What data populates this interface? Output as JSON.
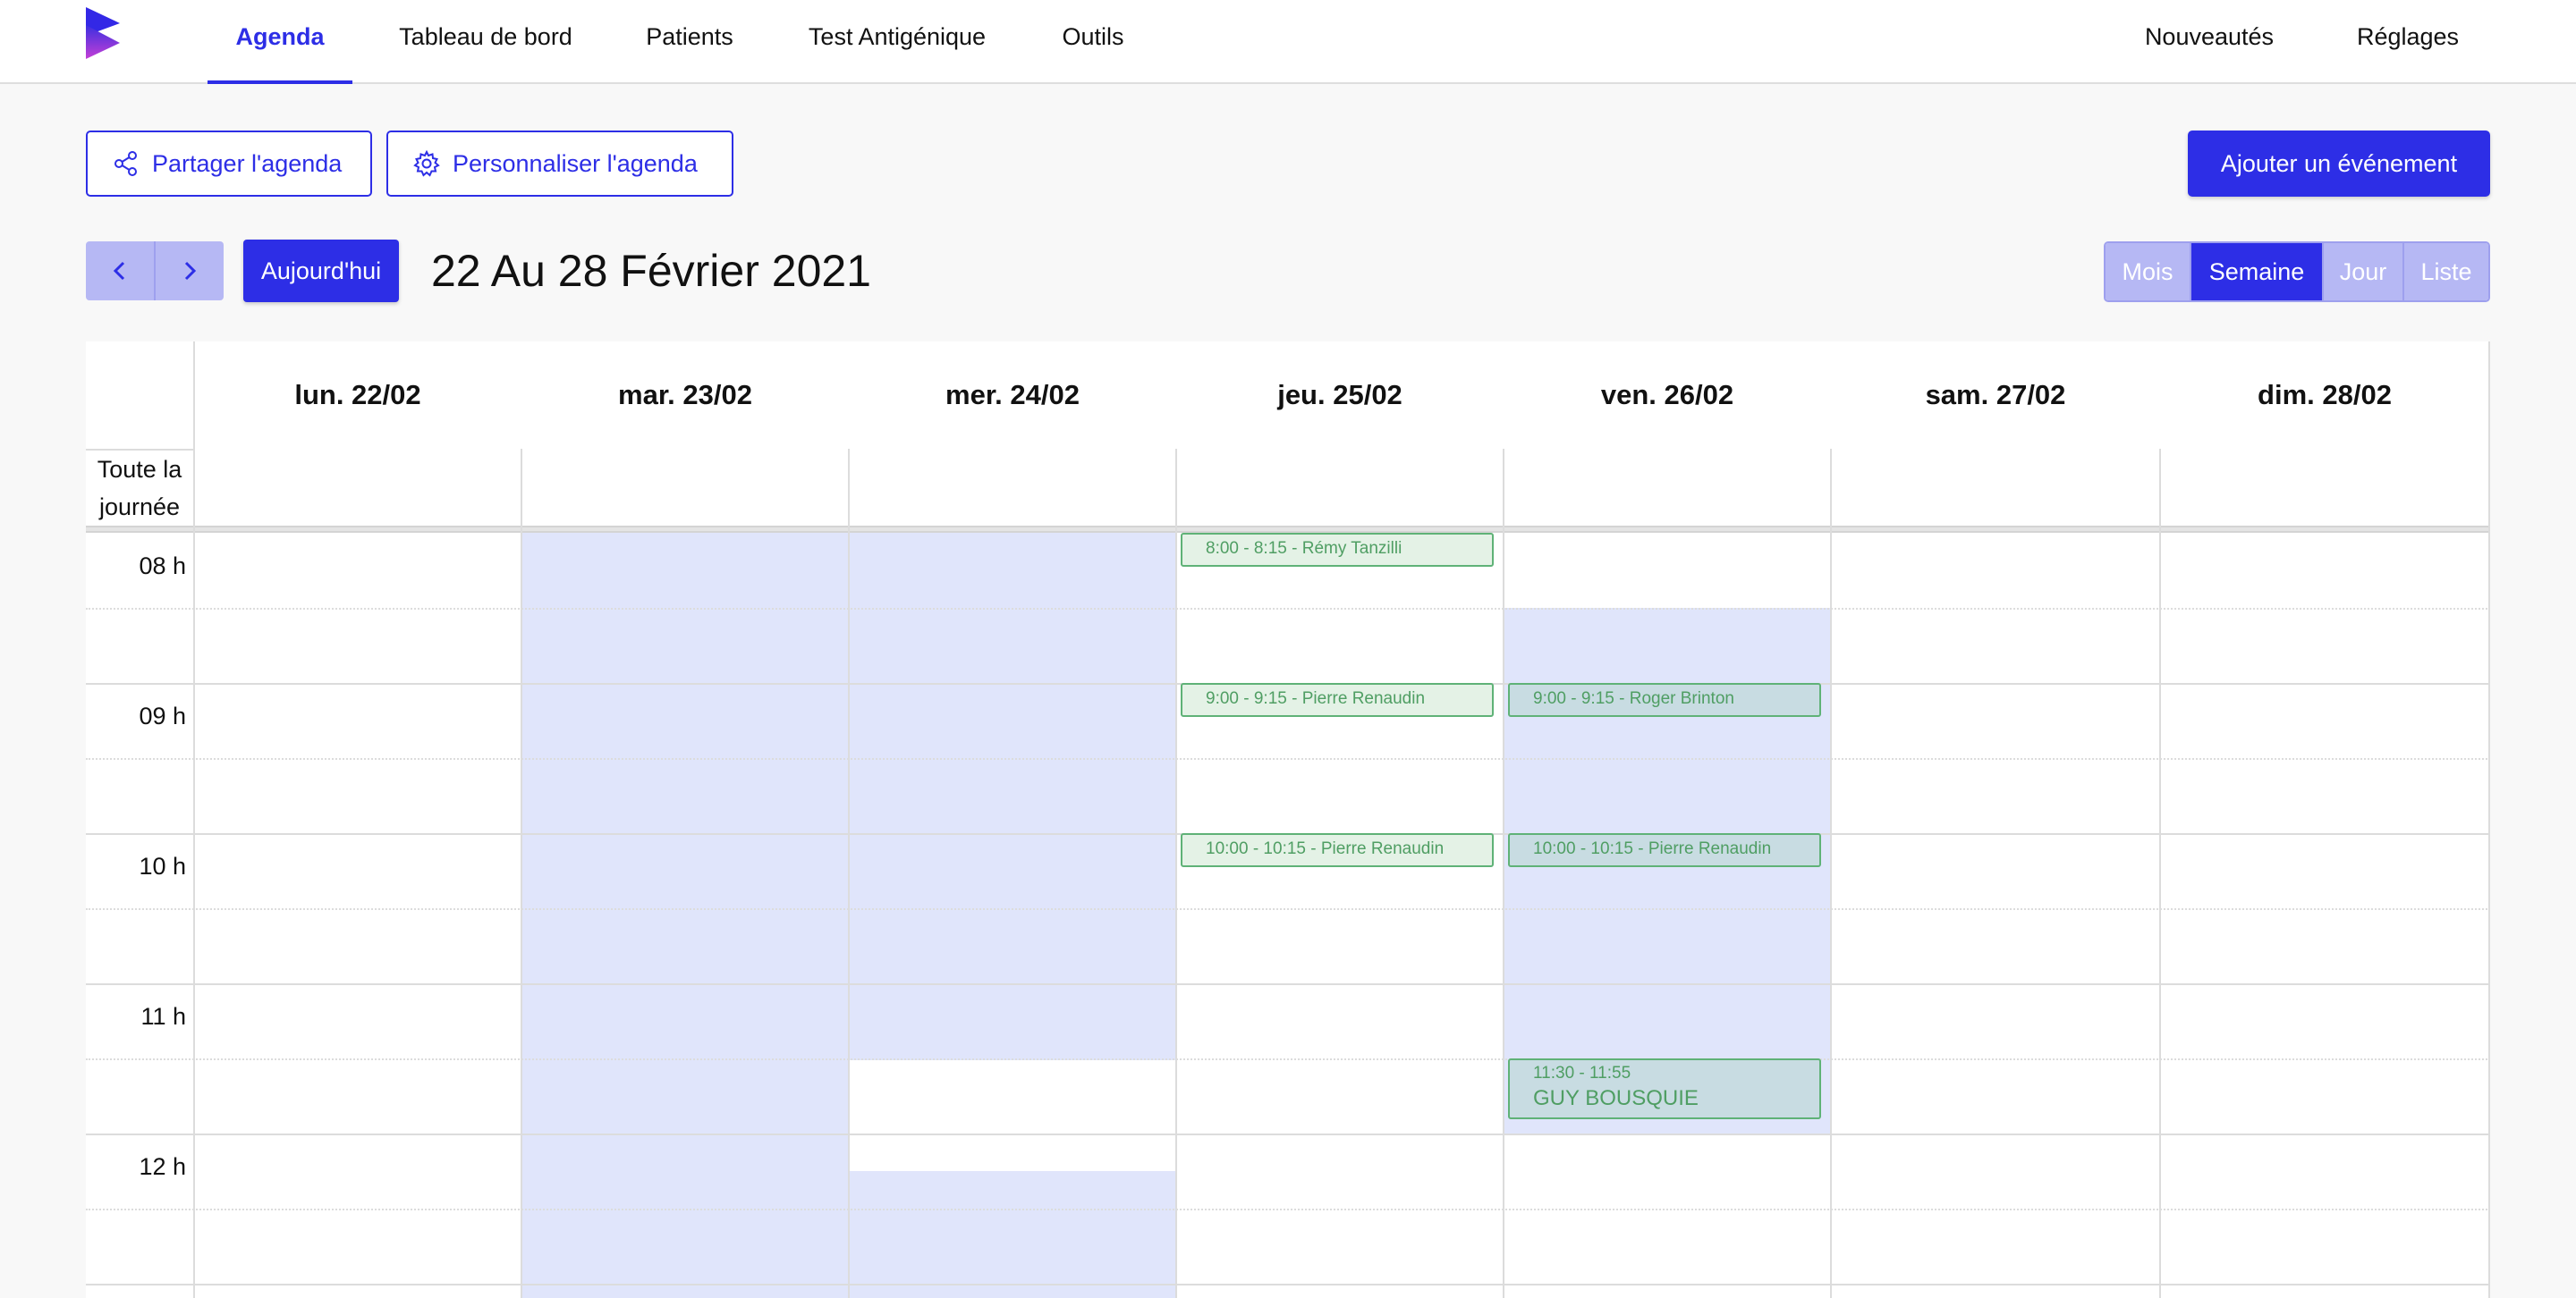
{
  "nav": {
    "items": [
      "Agenda",
      "Tableau de bord",
      "Patients",
      "Test Antigénique",
      "Outils"
    ],
    "right_items": [
      "Nouveautés",
      "Réglages"
    ],
    "active": "Agenda"
  },
  "toolbar": {
    "share_label": "Partager l'agenda",
    "customize_label": "Personnaliser l'agenda",
    "add_event_label": "Ajouter un événement"
  },
  "calendar_header": {
    "today_label": "Aujourd'hui",
    "range_title": "22 Au 28 Février 2021",
    "views": [
      "Mois",
      "Semaine",
      "Jour",
      "Liste"
    ],
    "active_view": "Semaine"
  },
  "calendar": {
    "days": [
      "lun. 22/02",
      "mar. 23/02",
      "mer. 24/02",
      "jeu. 25/02",
      "ven. 26/02",
      "sam. 27/02",
      "dim. 28/02"
    ],
    "all_day_label": "Toute la journée",
    "hours": [
      "08 h",
      "09 h",
      "10 h",
      "11 h",
      "12 h"
    ],
    "events": [
      {
        "day": "jeu. 25/02",
        "label": "8:00 - 8:15 - Rémy Tanzilli"
      },
      {
        "day": "jeu. 25/02",
        "label": "9:00 - 9:15 - Pierre Renaudin"
      },
      {
        "day": "jeu. 25/02",
        "label": "10:00 - 10:15 - Pierre Renaudin"
      },
      {
        "day": "ven. 26/02",
        "label": "9:00 - 9:15 - Roger Brinton"
      },
      {
        "day": "ven. 26/02",
        "label": "10:00 - 10:15 - Pierre Renaudin"
      },
      {
        "day": "ven. 26/02",
        "time": "11:30 - 11:55",
        "title": "GUY BOUSQUIE"
      }
    ]
  },
  "colors": {
    "accent": "#2d2ee6",
    "accent_light": "#b6b8f4",
    "availability": "#e0e5fb",
    "event_border": "#5fb277",
    "event_text": "#4f9e63"
  }
}
